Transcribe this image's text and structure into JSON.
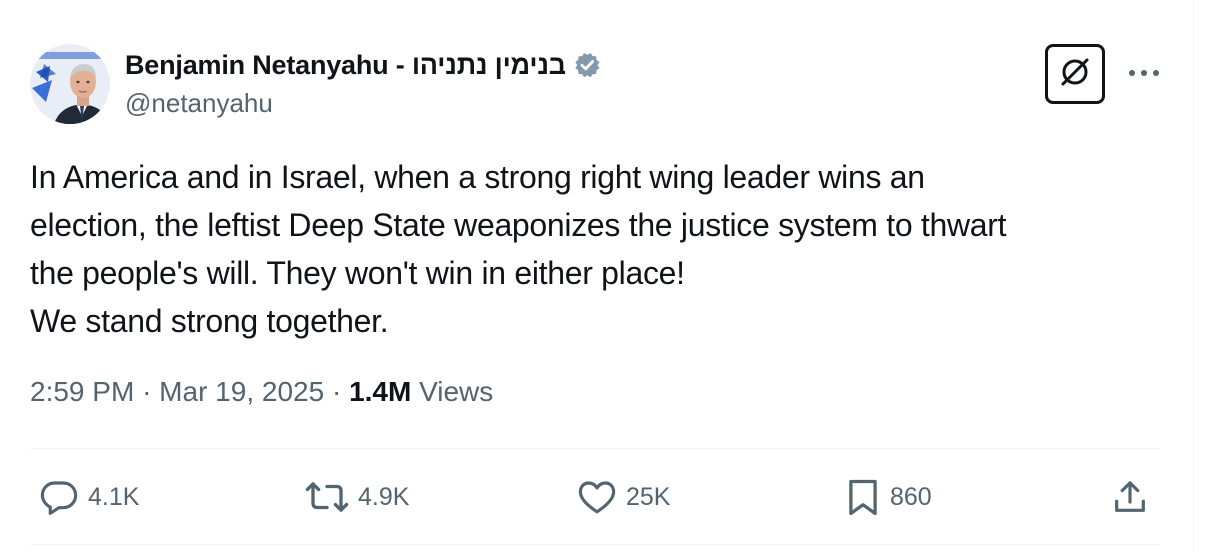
{
  "author": {
    "display_name": "Benjamin Netanyahu - בנימין נתניהו",
    "handle": "@netanyahu",
    "avatar_icon": "profile-photo-with-israeli-flag",
    "verified_badge_color": "#829aab"
  },
  "tweet": {
    "lines": [
      "In America and in Israel, when a strong right wing leader wins an",
      "election, the leftist Deep State weaponizes the justice system to thwart",
      "the people's will. They won't win in either place!",
      "We stand strong together."
    ]
  },
  "meta": {
    "time": "2:59 PM",
    "sep1": "·",
    "date": "Mar 19, 2025",
    "sep2": "·",
    "views_count": "1.4M",
    "views_label": "Views"
  },
  "actions": {
    "replies": "4.1K",
    "reposts": "4.9K",
    "likes": "25K",
    "bookmarks": "860"
  },
  "icons": {
    "grok": "grok-icon",
    "more": "more-dots-icon",
    "reply": "reply-icon",
    "repost": "repost-icon",
    "like": "heart-icon",
    "bookmark": "bookmark-icon",
    "share": "share-icon"
  },
  "colors": {
    "text_primary": "#0f1419",
    "text_secondary": "#536471",
    "divider": "#eff3f4"
  }
}
